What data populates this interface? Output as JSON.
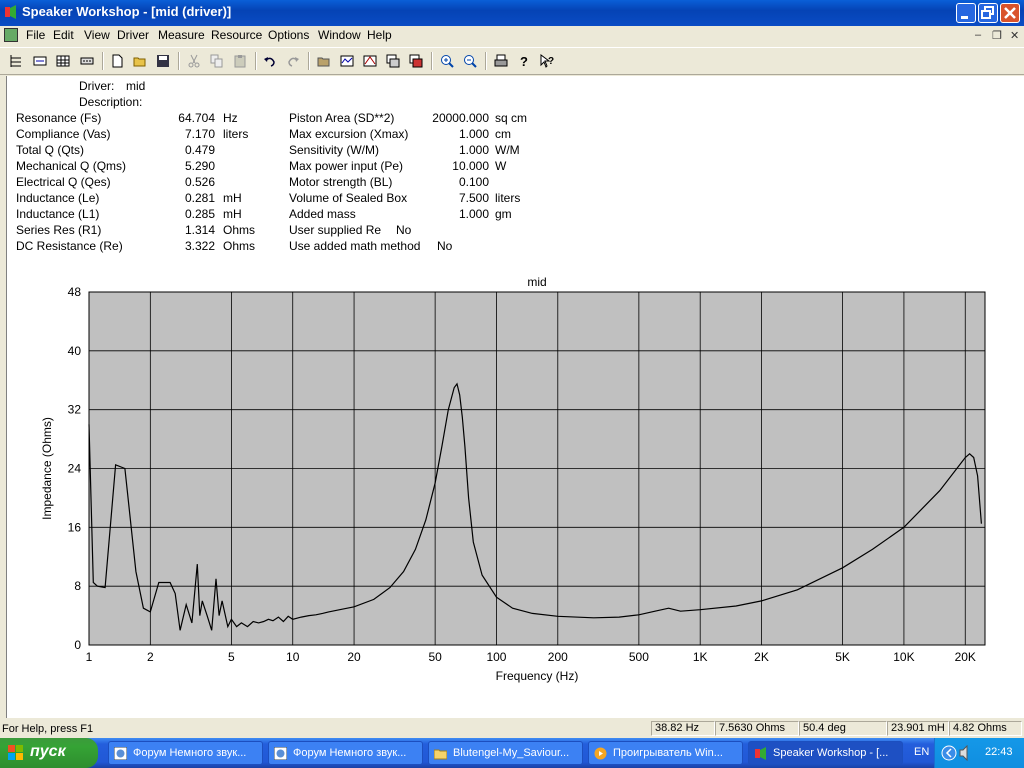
{
  "window": {
    "title": "Speaker Workshop - [mid (driver)]"
  },
  "menu": [
    "File",
    "Edit",
    "View",
    "Driver",
    "Measure",
    "Resource",
    "Options",
    "Window",
    "Help"
  ],
  "toolbar_icons": [
    "props-icon",
    "list-icon",
    "grid-icon",
    "data-icon",
    "new-icon",
    "open-icon",
    "save-icon",
    "cut-icon",
    "copy-icon",
    "paste-icon",
    "undo-icon",
    "redo-icon",
    "folder-icon",
    "chart1-icon",
    "chart2-icon",
    "chart3-icon",
    "chart4-icon",
    "zoom-in-icon",
    "zoom-out-icon",
    "print-icon",
    "help-icon",
    "context-help-icon"
  ],
  "driver": {
    "label": "Driver:",
    "name": "mid",
    "desc_label": "Description:",
    "desc": ""
  },
  "params_left": [
    {
      "label": "Resonance (Fs)",
      "value": "64.704",
      "unit": "Hz"
    },
    {
      "label": "Compliance (Vas)",
      "value": "7.170",
      "unit": "liters"
    },
    {
      "label": "Total Q (Qts)",
      "value": "0.479",
      "unit": ""
    },
    {
      "label": "Mechanical Q (Qms)",
      "value": "5.290",
      "unit": ""
    },
    {
      "label": "Electrical Q (Qes)",
      "value": "0.526",
      "unit": ""
    },
    {
      "label": "Inductance (Le)",
      "value": "0.281",
      "unit": "mH"
    },
    {
      "label": "Inductance (L1)",
      "value": "0.285",
      "unit": "mH"
    },
    {
      "label": "Series Res (R1)",
      "value": "1.314",
      "unit": "Ohms"
    },
    {
      "label": "DC Resistance (Re)",
      "value": "3.322",
      "unit": "Ohms"
    }
  ],
  "params_right": [
    {
      "label": "Piston Area (SD**2)",
      "value": "20000.000",
      "unit": "sq cm"
    },
    {
      "label": "Max excursion (Xmax)",
      "value": "1.000",
      "unit": "cm"
    },
    {
      "label": "Sensitivity (W/M)",
      "value": "1.000",
      "unit": "W/M"
    },
    {
      "label": "Max power input (Pe)",
      "value": "10.000",
      "unit": "W"
    },
    {
      "label": "Motor strength (BL)",
      "value": "0.100",
      "unit": ""
    },
    {
      "label": "Volume of Sealed Box",
      "value": "7.500",
      "unit": "liters"
    },
    {
      "label": "Added mass",
      "value": "1.000",
      "unit": "gm"
    },
    {
      "label": "User supplied Re",
      "value": "No",
      "unit": ""
    },
    {
      "label": "Use added math method",
      "value": "No",
      "unit": ""
    }
  ],
  "chart_data": {
    "type": "line",
    "title": "mid",
    "xlabel": "Frequency (Hz)",
    "ylabel": "Impedance (Ohms)",
    "xscale": "log",
    "xlim": [
      1,
      25000
    ],
    "ylim": [
      0,
      48
    ],
    "grid": true,
    "background": "#C0C0C0",
    "line_color": "#000000",
    "x_ticks": [
      1,
      2,
      5,
      10,
      20,
      50,
      100,
      200,
      500,
      1000,
      2000,
      5000,
      10000,
      20000
    ],
    "x_tick_labels": [
      "1",
      "2",
      "5",
      "10",
      "20",
      "50",
      "100",
      "200",
      "500",
      "1K",
      "2K",
      "5K",
      "10K",
      "20K"
    ],
    "y_ticks": [
      0,
      8,
      16,
      24,
      32,
      40,
      48
    ],
    "y_tick_labels": [
      "0",
      "8",
      "16",
      "24",
      "32",
      "40",
      "48"
    ],
    "series": [
      {
        "x": [
          1.0,
          1.05,
          1.1,
          1.2,
          1.35,
          1.5,
          1.7,
          1.85,
          2.0,
          2.2,
          2.5,
          2.65,
          2.8,
          3.0,
          3.2,
          3.4,
          3.5,
          3.6,
          3.8,
          4.0,
          4.2,
          4.35,
          4.5,
          4.8,
          5.0,
          5.3,
          5.6,
          6.0,
          6.4,
          6.8,
          7.2,
          7.6,
          8.0,
          8.5,
          9.0,
          9.5,
          10.0,
          11,
          12,
          13,
          14,
          15,
          17,
          20,
          25,
          30,
          35,
          40,
          45,
          50,
          54,
          58,
          62,
          64,
          66,
          68,
          70,
          73,
          77,
          85,
          100,
          120,
          150,
          200,
          300,
          400,
          500,
          600,
          700,
          800,
          1000,
          1500,
          2000,
          3000,
          5000,
          7000,
          10000,
          15000,
          20000,
          21000,
          22000,
          23000,
          24000
        ],
        "y": [
          30,
          8.5,
          8,
          7.8,
          24.5,
          24,
          10,
          5,
          4.5,
          8.5,
          8.5,
          7,
          2,
          5.5,
          3,
          11,
          4,
          6,
          4,
          2,
          9,
          4,
          6,
          2.5,
          3.5,
          2.5,
          3,
          2.5,
          3.2,
          3,
          3.2,
          3.5,
          3.3,
          3.8,
          3.2,
          3.9,
          3.5,
          3.8,
          4,
          4.1,
          4.3,
          4.5,
          4.8,
          5.2,
          6.2,
          7.8,
          10,
          13,
          17,
          22,
          27,
          32,
          35,
          35.5,
          34,
          31,
          27,
          20,
          14,
          9.5,
          6.5,
          5,
          4.3,
          3.9,
          3.7,
          3.8,
          4.1,
          4.6,
          5,
          4.6,
          4.8,
          5.3,
          6,
          7.5,
          10.5,
          13,
          16,
          21,
          25.5,
          26,
          25.5,
          23,
          16.5
        ]
      }
    ]
  },
  "status": {
    "help": "For Help, press F1",
    "freq": "38.82 Hz",
    "ohms": "7.5630 Ohms",
    "deg": "50.4 deg",
    "mh": "23.901 mH",
    "ohms2": "4.82 Ohms"
  },
  "taskbar": {
    "start": "пуск",
    "tasks": [
      "Форум Немного звук...",
      "Форум Немного звук...",
      "Blutengel-My_Saviour...",
      "Проигрыватель Win...",
      "Speaker Workshop - [..."
    ],
    "lang": "EN",
    "time": "22:43"
  }
}
